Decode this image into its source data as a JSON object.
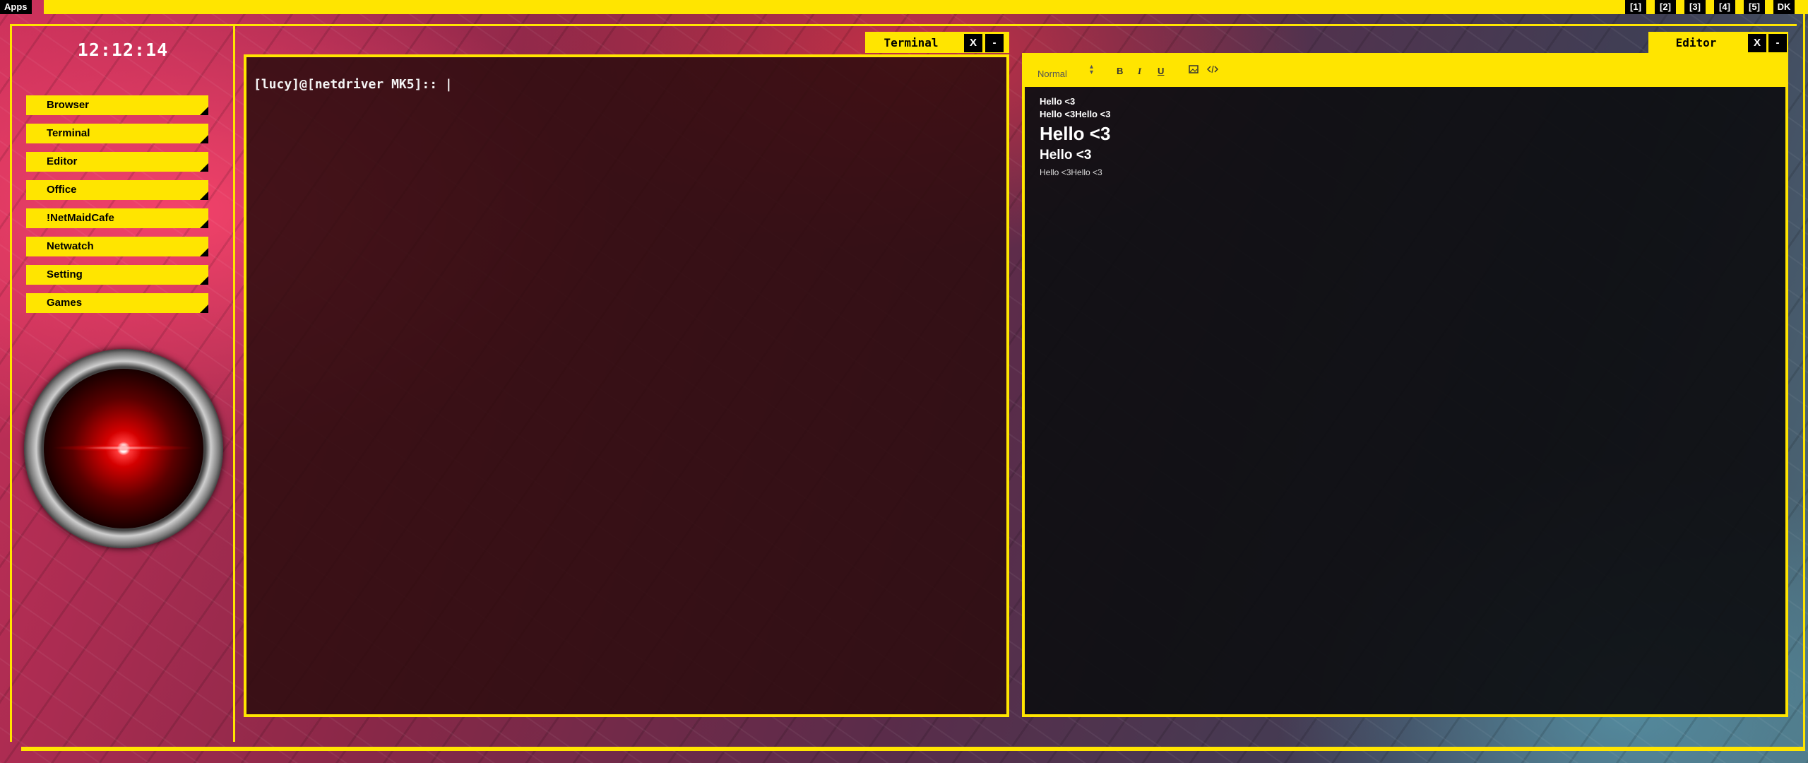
{
  "topbar": {
    "apps_label": "Apps",
    "workspaces": [
      "[1]",
      "[2]",
      "[3]",
      "[4]",
      "[5]"
    ],
    "layout_label": "DK",
    "accent_color": "#ffe500"
  },
  "sidebar": {
    "clock": "12:12:14",
    "apps": [
      "Browser",
      "Terminal",
      "Editor",
      "Office",
      "!NetMaidCafe",
      "Netwatch",
      "Setting",
      "Games"
    ]
  },
  "terminal": {
    "title": "Terminal",
    "close_label": "X",
    "minimize_label": "-",
    "prompt": "[lucy]@[netdriver MK5]:: |"
  },
  "editor": {
    "title": "Editor",
    "close_label": "X",
    "minimize_label": "-",
    "toolbar": {
      "format_select": "Normal",
      "icons": [
        "bold-icon",
        "italic-icon",
        "underline-icon",
        "image-icon",
        "code-icon"
      ],
      "bold_glyph": "B",
      "italic_glyph": "I",
      "underline_glyph": "U"
    },
    "content": [
      "Hello <3",
      "Hello <3Hello <3",
      "Hello <3",
      "Hello <3",
      "Hello <3Hello <3"
    ]
  }
}
